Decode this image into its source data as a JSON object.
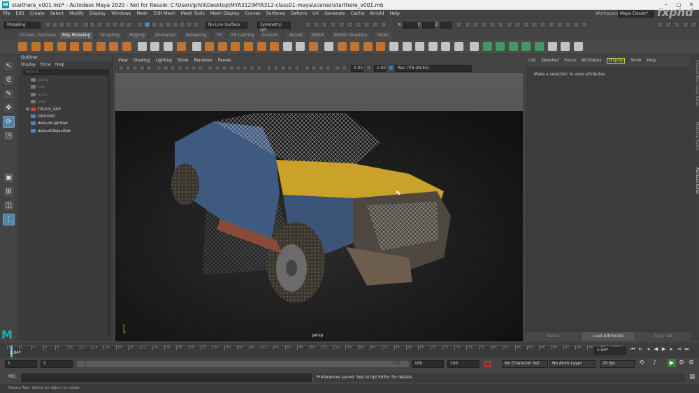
{
  "window": {
    "title": "starthere_v001.mb* - Autodesk Maya 2020 - Not for Resale: C:\\Users\\phili\\Desktop\\MYA312\\MYA312-class01-maya\\scenes\\starthere_v001.mb",
    "app_icon": "M"
  },
  "menus": [
    "File",
    "Edit",
    "Create",
    "Select",
    "Modify",
    "Display",
    "Windows",
    "Mesh",
    "Edit Mesh",
    "Mesh Tools",
    "Mesh Display",
    "Curves",
    "Surfaces",
    "Deform",
    "UV",
    "Generate",
    "Cache",
    "Arnold",
    "Help"
  ],
  "workspace": {
    "label": "Workspace :",
    "value": "Maya Classic*"
  },
  "watermark": "fxphd",
  "status_line": {
    "mode": "Modeling",
    "live_surface": "No Live Surface",
    "symmetry": "Symmetry: Off",
    "x_label": "X:",
    "y_label": "Y:",
    "z_label": "Z:"
  },
  "shelf_tabs": [
    "Curves / Surfaces",
    "Poly Modeling",
    "Sculpting",
    "Rigging",
    "Animation",
    "Rendering",
    "FX",
    "FX Caching",
    "Custom",
    "Arnold",
    "MASH",
    "Motion Graphics",
    "XGen"
  ],
  "shelf_active": "Poly Modeling",
  "outliner": {
    "title": "Outliner",
    "menu": [
      "Display",
      "Show",
      "Help"
    ],
    "search_placeholder": "Search...",
    "items": [
      {
        "label": "persp",
        "type": "camera",
        "dim": true
      },
      {
        "label": "top",
        "type": "camera",
        "dim": true
      },
      {
        "label": "front",
        "type": "camera",
        "dim": true
      },
      {
        "label": "side",
        "type": "camera",
        "dim": true
      },
      {
        "label": "TRUCK_GRP",
        "type": "group",
        "dim": false
      },
      {
        "label": "GROUND",
        "type": "mesh",
        "dim": false
      },
      {
        "label": "defaultLightSet",
        "type": "set",
        "dim": false
      },
      {
        "label": "defaultObjectSet",
        "type": "set",
        "dim": false
      }
    ]
  },
  "viewport": {
    "menu": [
      "View",
      "Shading",
      "Lighting",
      "Show",
      "Renderer",
      "Panels"
    ],
    "exposure": "0.00",
    "gamma": "1.00",
    "color_space": "Rec.709 (ACES)",
    "camera_label": "persp"
  },
  "attribute_editor": {
    "tabs": [
      "List",
      "Selected",
      "Focus",
      "Attributes",
      "Display",
      "Show",
      "Help"
    ],
    "active_tab": "Display",
    "message": "Make a selection to view attributes",
    "buttons": [
      "Select",
      "Load Attributes",
      "Copy Tab"
    ]
  },
  "side_tabs": [
    "Channel Box / Layer Editor",
    "Modeling Toolkit",
    "Attribute Editor"
  ],
  "timeline": {
    "ticks": [
      "1",
      "2",
      "4",
      "6",
      "8",
      "10",
      "12",
      "14",
      "16",
      "18",
      "20",
      "22",
      "24",
      "26",
      "28",
      "30",
      "32",
      "34",
      "36",
      "38",
      "40",
      "42",
      "44",
      "46",
      "48",
      "50",
      "52",
      "54",
      "56",
      "58",
      "60",
      "62",
      "64",
      "66",
      "68",
      "70",
      "72",
      "74",
      "76",
      "78",
      "80",
      "82",
      "84",
      "86",
      "88",
      "90",
      "92",
      "94",
      "96",
      "98",
      "100"
    ],
    "current_frame_field": "1.04*",
    "current_frame_marker": "1.04*"
  },
  "range": {
    "start": "1",
    "start_inner": "1",
    "slider_start": "1",
    "slider_end": "100",
    "end_inner": "100",
    "end": "100",
    "character_set": "No Character Set",
    "anim_layer": "No Anim Layer",
    "fps": "25 fps"
  },
  "command_line": {
    "lang": "MEL",
    "result": "Preferences saved. See Script Editor for details."
  },
  "help_line": "Rotate Tool: Select an object to rotate.",
  "colors": {
    "accent_active": "#5285a6",
    "maya_logo": "#18b5b0",
    "display_tab": "#c7e33a"
  }
}
